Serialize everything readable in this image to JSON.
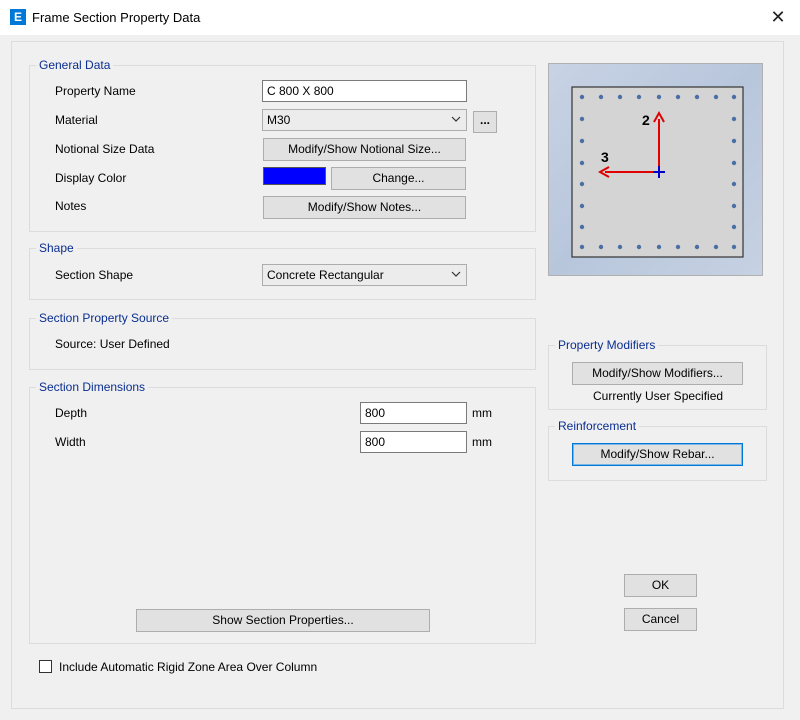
{
  "window": {
    "title": "Frame Section Property Data",
    "app_icon_letter": "E",
    "close_glyph": "✕"
  },
  "general_data": {
    "label": "General Data",
    "property_name_label": "Property Name",
    "property_name_value": "C 800 X 800",
    "material_label": "Material",
    "material_value": "M30",
    "ellipsis_label": "...",
    "notional_label": "Notional Size Data",
    "notional_button": "Modify/Show Notional Size...",
    "display_color_label": "Display Color",
    "display_color_value": "#0000ff",
    "change_button": "Change...",
    "notes_label": "Notes",
    "notes_button": "Modify/Show Notes..."
  },
  "shape": {
    "label": "Shape",
    "section_shape_label": "Section Shape",
    "section_shape_value": "Concrete Rectangular"
  },
  "source": {
    "label": "Section Property Source",
    "text": "Source:  User Defined"
  },
  "dimensions": {
    "label": "Section Dimensions",
    "depth_label": "Depth",
    "depth_value": "800",
    "width_label": "Width",
    "width_value": "800",
    "unit": "mm",
    "show_properties_button": "Show Section Properties..."
  },
  "preview": {
    "axis_2_label": "2",
    "axis_3_label": "3"
  },
  "modifiers": {
    "label": "Property Modifiers",
    "button": "Modify/Show Modifiers...",
    "status": "Currently User Specified"
  },
  "reinforcement": {
    "label": "Reinforcement",
    "button": "Modify/Show Rebar..."
  },
  "buttons": {
    "ok": "OK",
    "cancel": "Cancel"
  },
  "rigid_zone": {
    "label": "Include Automatic Rigid Zone Area Over Column",
    "checked": false
  },
  "colors": {
    "group_label": "#0a2e90",
    "rebar": "#4a6fa5",
    "axis_red": "#e00000",
    "axis_blue": "#0000cc"
  }
}
